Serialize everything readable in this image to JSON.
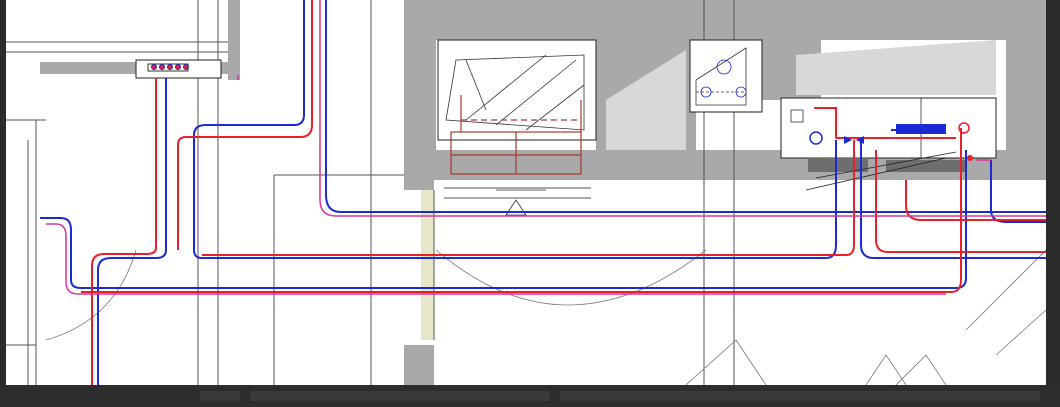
{
  "viewport": {
    "background": "#ffffff"
  },
  "colors": {
    "supply": "#e8202a",
    "return": "#1a2bd6",
    "magenta": "#d6359a",
    "wall": "#a9a9a9",
    "linework": "#555555",
    "equipment": "#a33b2f"
  },
  "status": {
    "text": ""
  },
  "icons": [
    "manifold-icon",
    "valve-icon",
    "pump-icon",
    "door-swing-icon"
  ]
}
